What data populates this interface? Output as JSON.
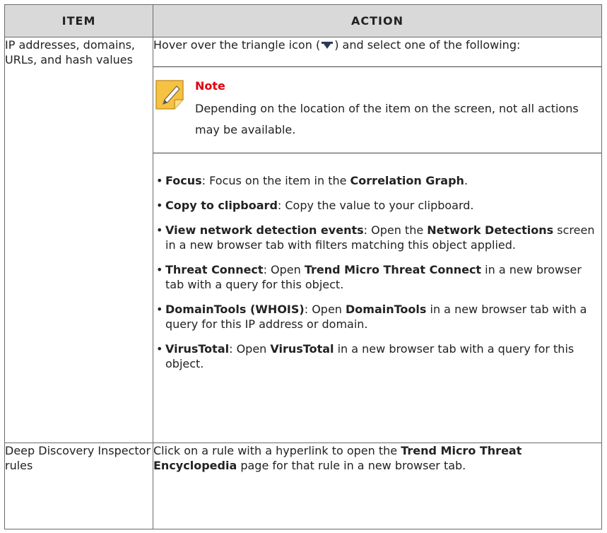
{
  "header": {
    "item": "ITEM",
    "action": "ACTION"
  },
  "row1": {
    "item": "IP addresses, domains, URLs, and hash values",
    "intro_before": "Hover over the triangle icon (",
    "intro_after": ") and select one of the following:",
    "icon": "triangle-dropdown-icon",
    "note": {
      "icon": "note-pencil-icon",
      "title": "Note",
      "text": "Depending on the location of the item on the screen, not all actions may be available."
    },
    "bullets": [
      {
        "b1": "Focus",
        "t1": ": Focus on the item in the ",
        "b2": "Correlation Graph",
        "t2": "."
      },
      {
        "b1": "Copy to clipboard",
        "t1": ": Copy the value to your clipboard."
      },
      {
        "b1": "View network detection events",
        "t1": ": Open the ",
        "b2": "Network Detections",
        "t2": " screen in a new browser tab with filters matching this object applied."
      },
      {
        "b1": "Threat Connect",
        "t1": ": Open ",
        "b2": "Trend Micro Threat Connect",
        "t2": " in a new browser tab with a query for this object."
      },
      {
        "b1": "DomainTools (WHOIS)",
        "t1": ": Open ",
        "b2": "DomainTools",
        "t2": " in a new browser tab with a query for this IP address or domain."
      },
      {
        "b1": "VirusTotal",
        "t1": ": Open ",
        "b2": "VirusTotal",
        "t2": " in a new browser tab with a query for this object."
      }
    ]
  },
  "row2": {
    "item": "Deep Discovery Inspector rules",
    "t1": "Click on a rule with a hyperlink to open the ",
    "b1": "Trend Micro Threat Encyclopedia",
    "t2": " page for that rule in a new browser tab."
  },
  "colors": {
    "header_bg": "#d9d9d9",
    "note_title": "#e3000f",
    "note_icon": "#f5c242",
    "border": "#6b6b6b"
  }
}
